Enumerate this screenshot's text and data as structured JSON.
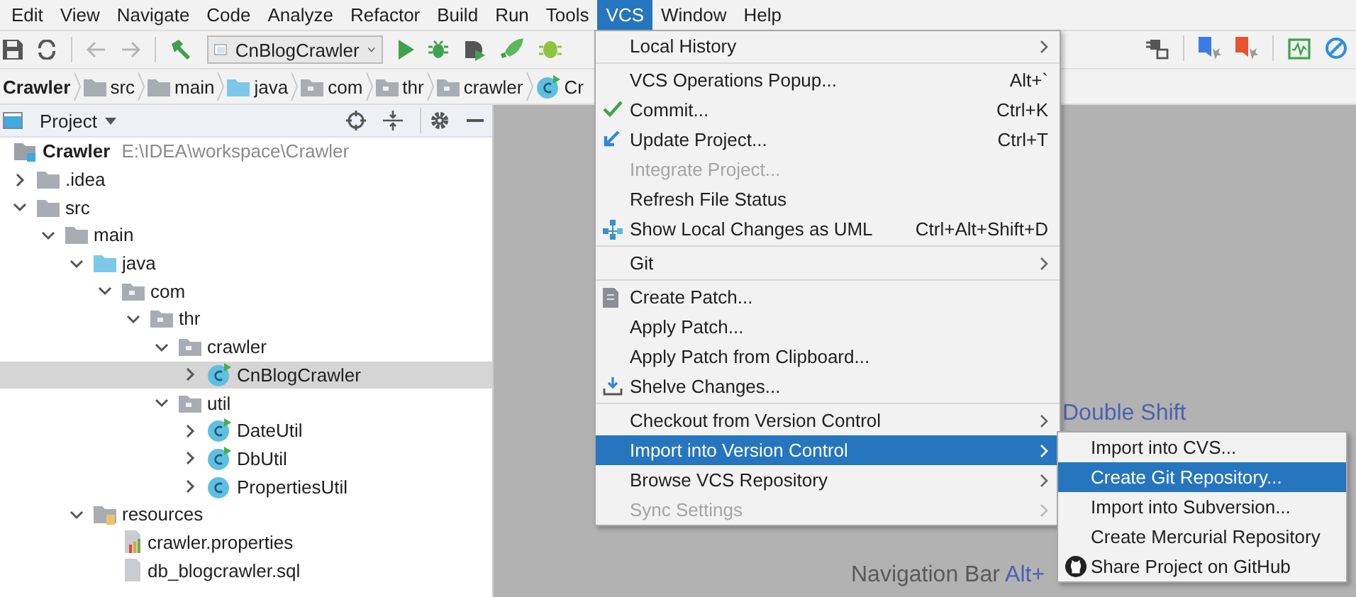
{
  "menubar": [
    {
      "label": "Edit",
      "selected": false
    },
    {
      "label": "View",
      "selected": false
    },
    {
      "label": "Navigate",
      "selected": false
    },
    {
      "label": "Code",
      "selected": false
    },
    {
      "label": "Analyze",
      "selected": false
    },
    {
      "label": "Refactor",
      "selected": false
    },
    {
      "label": "Build",
      "selected": false
    },
    {
      "label": "Run",
      "selected": false
    },
    {
      "label": "Tools",
      "selected": false
    },
    {
      "label": "VCS",
      "selected": true
    },
    {
      "label": "Window",
      "selected": false
    },
    {
      "label": "Help",
      "selected": false
    }
  ],
  "toolbar": {
    "run_config": "CnBlogCrawler"
  },
  "breadcrumb": [
    {
      "label": "Crawler",
      "kind": "module"
    },
    {
      "label": "src",
      "kind": "folder"
    },
    {
      "label": "main",
      "kind": "folder"
    },
    {
      "label": "java",
      "kind": "source"
    },
    {
      "label": "com",
      "kind": "package"
    },
    {
      "label": "thr",
      "kind": "package"
    },
    {
      "label": "crawler",
      "kind": "package"
    },
    {
      "label": "Cr",
      "kind": "class"
    }
  ],
  "project_panel": {
    "title": "Project",
    "tree": [
      {
        "label": "Crawler",
        "path": "E:\\IDEA\\workspace\\Crawler",
        "kind": "module",
        "selected": false,
        "children": [
          {
            "label": ".idea",
            "kind": "folder",
            "expanded": false,
            "selected": false
          },
          {
            "label": "src",
            "kind": "folder",
            "expanded": true,
            "selected": false,
            "children": [
              {
                "label": "main",
                "kind": "folder",
                "expanded": true,
                "selected": false,
                "children": [
                  {
                    "label": "java",
                    "kind": "source",
                    "expanded": true,
                    "selected": false,
                    "children": [
                      {
                        "label": "com",
                        "kind": "package",
                        "expanded": true,
                        "selected": false,
                        "children": [
                          {
                            "label": "thr",
                            "kind": "package",
                            "expanded": true,
                            "selected": false,
                            "children": [
                              {
                                "label": "crawler",
                                "kind": "package",
                                "expanded": true,
                                "selected": false,
                                "children": [
                                  {
                                    "label": "CnBlogCrawler",
                                    "kind": "class",
                                    "expanded": false,
                                    "selected": true
                                  }
                                ]
                              },
                              {
                                "label": "util",
                                "kind": "package",
                                "expanded": true,
                                "selected": false,
                                "children": [
                                  {
                                    "label": "DateUtil",
                                    "kind": "class",
                                    "expanded": false,
                                    "selected": false
                                  },
                                  {
                                    "label": "DbUtil",
                                    "kind": "class",
                                    "expanded": false,
                                    "selected": false
                                  },
                                  {
                                    "label": "PropertiesUtil",
                                    "kind": "plainclass",
                                    "expanded": false,
                                    "selected": false
                                  }
                                ]
                              }
                            ]
                          }
                        ]
                      }
                    ]
                  },
                  {
                    "label": "resources",
                    "kind": "resources",
                    "expanded": true,
                    "selected": false,
                    "children": [
                      {
                        "label": "crawler.properties",
                        "kind": "properties",
                        "selected": false
                      },
                      {
                        "label": "db_blogcrawler.sql",
                        "kind": "file",
                        "selected": false
                      }
                    ]
                  }
                ]
              }
            ]
          }
        ]
      }
    ]
  },
  "editor_hints": [
    {
      "label": "Double Shift"
    },
    {
      "label": "Navigation Bar",
      "shortcut": "Alt+"
    }
  ],
  "vcs_menu": [
    {
      "kind": "item",
      "label": "Local History",
      "submenu": true,
      "disabled": false,
      "selected": false
    },
    {
      "kind": "separator"
    },
    {
      "kind": "item",
      "label": "VCS Operations Popup...",
      "shortcut": "Alt+`",
      "submenu": false,
      "disabled": false,
      "selected": false
    },
    {
      "kind": "check",
      "label": "Commit...",
      "shortcut": "Ctrl+K",
      "submenu": false,
      "disabled": false,
      "selected": false
    },
    {
      "kind": "arrow",
      "label": "Update Project...",
      "shortcut": "Ctrl+T",
      "submenu": false,
      "disabled": false,
      "selected": false
    },
    {
      "kind": "item",
      "label": "Integrate Project...",
      "submenu": false,
      "disabled": true,
      "selected": false
    },
    {
      "kind": "item",
      "label": "Refresh File Status",
      "submenu": false,
      "disabled": false,
      "selected": false
    },
    {
      "kind": "diagram",
      "label": "Show Local Changes as UML",
      "shortcut": "Ctrl+Alt+Shift+D",
      "submenu": false,
      "disabled": false,
      "selected": false
    },
    {
      "kind": "separator"
    },
    {
      "kind": "item",
      "label": "Git",
      "submenu": true,
      "disabled": false,
      "selected": false
    },
    {
      "kind": "separator"
    },
    {
      "kind": "document",
      "label": "Create Patch...",
      "submenu": false,
      "disabled": false,
      "selected": false
    },
    {
      "kind": "item",
      "label": "Apply Patch...",
      "submenu": false,
      "disabled": false,
      "selected": false
    },
    {
      "kind": "item",
      "label": "Apply Patch from Clipboard...",
      "submenu": false,
      "disabled": false,
      "selected": false
    },
    {
      "kind": "tray",
      "label": "Shelve Changes...",
      "submenu": false,
      "disabled": false,
      "selected": false
    },
    {
      "kind": "separator"
    },
    {
      "kind": "item",
      "label": "Checkout from Version Control",
      "submenu": true,
      "disabled": false,
      "selected": false
    },
    {
      "kind": "item",
      "label": "Import into Version Control",
      "submenu": true,
      "disabled": false,
      "selected": true
    },
    {
      "kind": "item",
      "label": "Browse VCS Repository",
      "submenu": true,
      "disabled": false,
      "selected": false
    },
    {
      "kind": "item",
      "label": "Sync Settings",
      "submenu": true,
      "disabled": true,
      "selected": false
    }
  ],
  "import_submenu": [
    {
      "label": "Import into CVS...",
      "selected": false
    },
    {
      "label": "Create Git Repository...",
      "selected": true
    },
    {
      "label": "Import into Subversion...",
      "selected": false
    },
    {
      "label": "Create Mercurial Repository",
      "selected": false
    },
    {
      "label": "Share Project on GitHub",
      "kind": "github",
      "selected": false
    }
  ]
}
